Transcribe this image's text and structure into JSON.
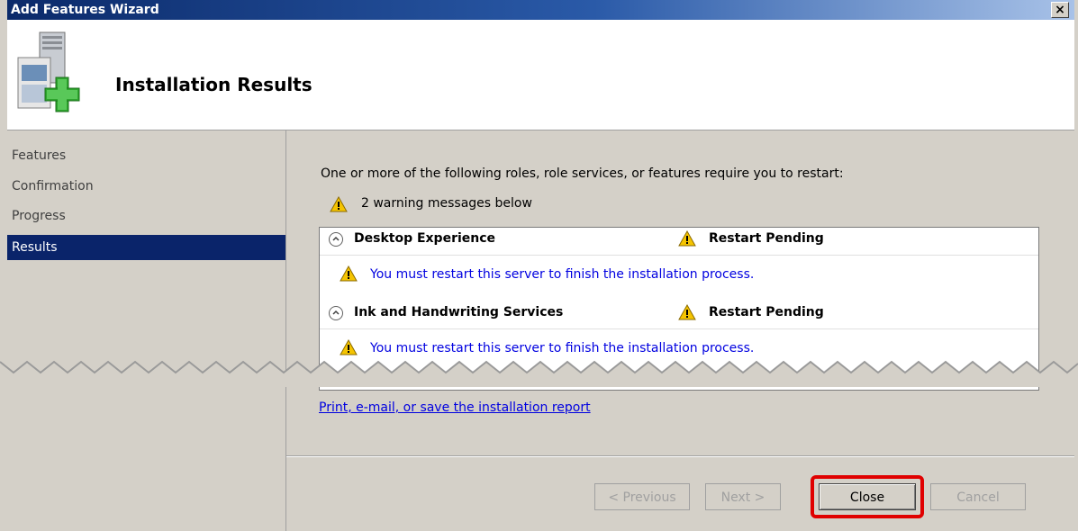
{
  "window": {
    "title": "Add Features Wizard",
    "close_label": "×"
  },
  "header": {
    "page_title": "Installation Results"
  },
  "sidebar": {
    "items": [
      {
        "label": "Features"
      },
      {
        "label": "Confirmation"
      },
      {
        "label": "Progress"
      },
      {
        "label": "Results",
        "active": true
      }
    ]
  },
  "main": {
    "intro": "One or more of the following roles, role services, or features require you to restart:",
    "warning_summary": "2 warning messages below",
    "results": [
      {
        "name": "Desktop Experience",
        "status": "Restart Pending",
        "message": "You must restart this server to finish the installation process."
      },
      {
        "name": "Ink and Handwriting Services",
        "status": "Restart Pending",
        "message": "You must restart this server to finish the installation process."
      }
    ],
    "report_link": "Print, e-mail, or save the installation report"
  },
  "buttons": {
    "previous": "< Previous",
    "next": "Next >",
    "close": "Close",
    "cancel": "Cancel"
  },
  "colors": {
    "selection": "#0a246a",
    "link": "#0000e0",
    "highlight": "#e00000",
    "warning": "#f5c400"
  },
  "icons": [
    "server-add-icon",
    "warning-icon",
    "collapse-chevron-icon"
  ]
}
